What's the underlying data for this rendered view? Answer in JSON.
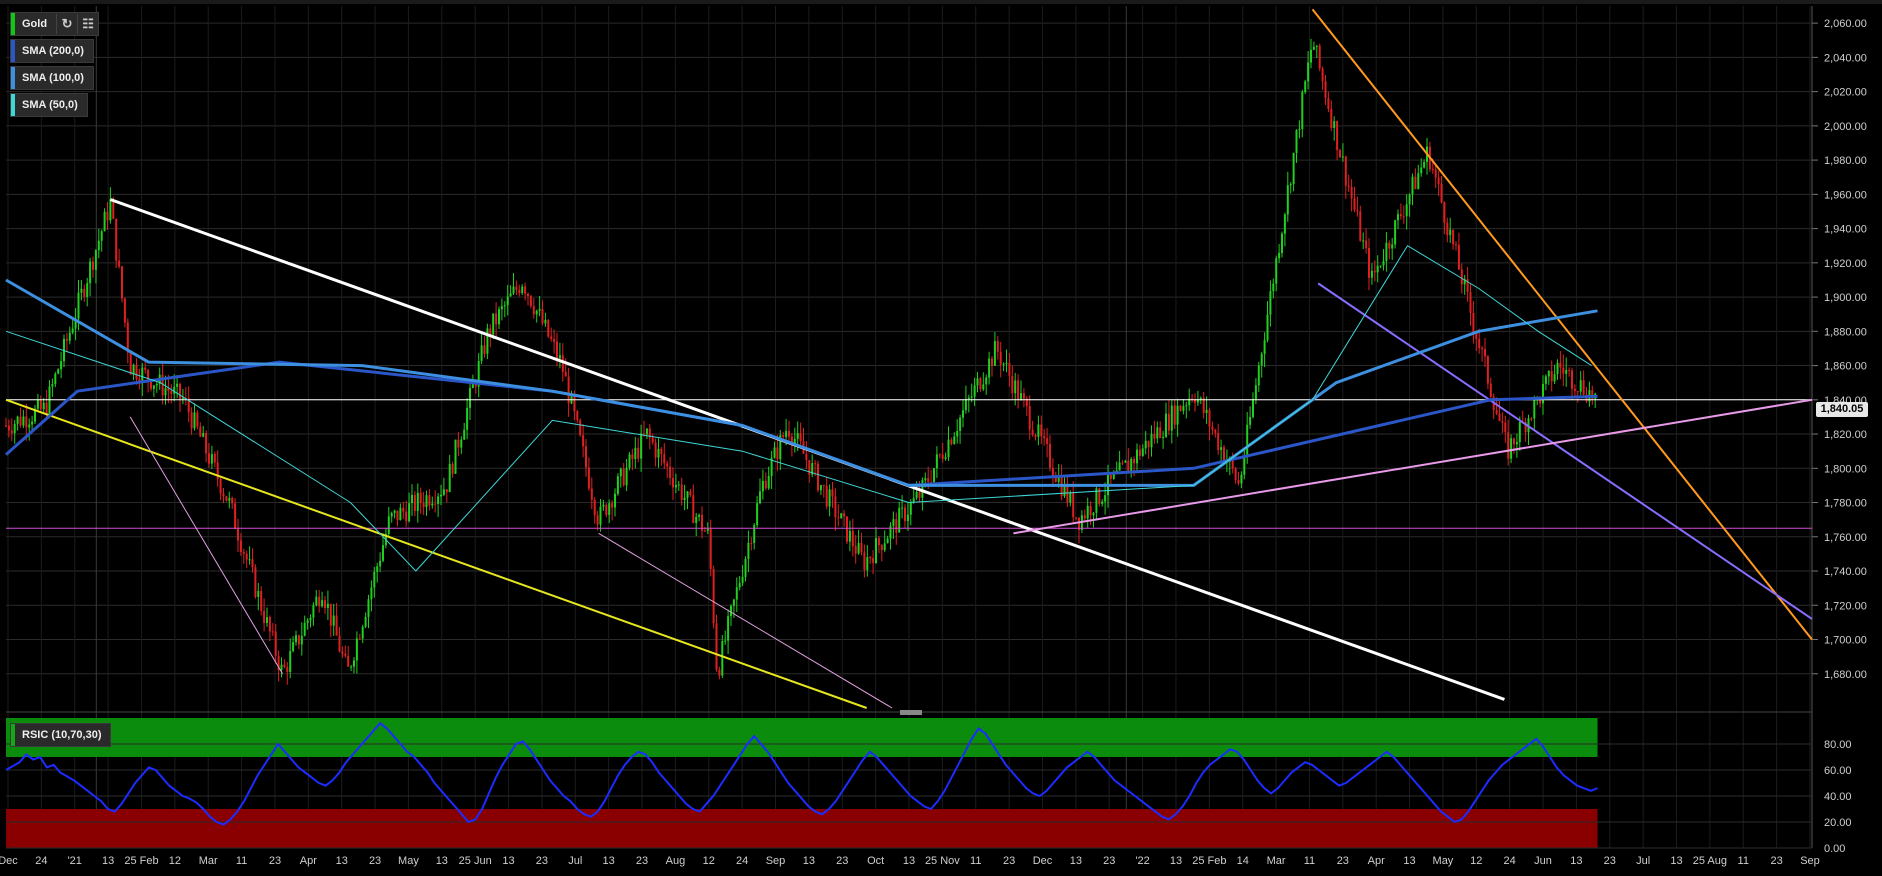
{
  "instrument": {
    "name": "Gold",
    "color": "#11c811"
  },
  "legend": [
    {
      "label": "SMA (200,0)",
      "color": "#2a56c8"
    },
    {
      "label": "SMA (100,0)",
      "color": "#3d8fe0"
    },
    {
      "label": "SMA (50,0)",
      "color": "#3fd6d6"
    }
  ],
  "rsi_legend": {
    "label": "RSIC (10,70,30)",
    "color": "#15a815"
  },
  "toolbar": {
    "refresh_icon": "refresh-icon",
    "settings_icon": "chart-settings-icon"
  },
  "last_price": "1,840.05",
  "chart_data": [
    {
      "type": "candlestick",
      "title": "Gold",
      "ylim": [
        1660,
        2070
      ],
      "y_ticks": [
        "2,060.00",
        "2,040.00",
        "2,020.00",
        "2,000.00",
        "1,980.00",
        "1,960.00",
        "1,940.00",
        "1,920.00",
        "1,900.00",
        "1,880.00",
        "1,860.00",
        "1,840.00",
        "1,820.00",
        "1,800.00",
        "1,780.00",
        "1,760.00",
        "1,740.00",
        "1,720.00",
        "1,700.00",
        "1,680.00"
      ],
      "x_ticks": [
        "Dec",
        "24",
        "'21",
        "13",
        "25 Feb",
        "12",
        "Mar",
        "11",
        "23",
        "Apr",
        "13",
        "23",
        "May",
        "13",
        "25 Jun",
        "13",
        "23",
        "Jul",
        "13",
        "23",
        "Aug",
        "12",
        "24",
        "Sep",
        "13",
        "23",
        "Oct",
        "13",
        "25 Nov",
        "11",
        "23",
        "Dec",
        "13",
        "23",
        "'22",
        "13",
        "25 Feb",
        "14",
        "Mar",
        "11",
        "23",
        "Apr",
        "13",
        "May",
        "12",
        "24",
        "Jun",
        "13",
        "23",
        "Jul",
        "13",
        "25 Aug",
        "11",
        "23",
        "Sep"
      ],
      "approx_close_path": [
        [
          "2020-11-30",
          1825
        ],
        [
          "2020-12-14",
          1835
        ],
        [
          "2021-01-06",
          1955
        ],
        [
          "2021-01-13",
          1860
        ],
        [
          "2021-02-01",
          1840
        ],
        [
          "2021-02-17",
          1780
        ],
        [
          "2021-03-08",
          1680
        ],
        [
          "2021-03-22",
          1730
        ],
        [
          "2021-03-31",
          1680
        ],
        [
          "2021-04-15",
          1770
        ],
        [
          "2021-05-05",
          1790
        ],
        [
          "2021-05-20",
          1880
        ],
        [
          "2021-06-01",
          1910
        ],
        [
          "2021-06-15",
          1860
        ],
        [
          "2021-06-28",
          1770
        ],
        [
          "2021-07-15",
          1820
        ],
        [
          "2021-08-06",
          1760
        ],
        [
          "2021-08-09",
          1680
        ],
        [
          "2021-08-25",
          1790
        ],
        [
          "2021-09-03",
          1825
        ],
        [
          "2021-09-30",
          1745
        ],
        [
          "2021-10-20",
          1785
        ],
        [
          "2021-11-16",
          1870
        ],
        [
          "2021-12-15",
          1770
        ],
        [
          "2022-01-25",
          1845
        ],
        [
          "2022-02-10",
          1790
        ],
        [
          "2022-03-08",
          2050
        ],
        [
          "2022-03-29",
          1910
        ],
        [
          "2022-04-18",
          1985
        ],
        [
          "2022-05-16",
          1810
        ],
        [
          "2022-06-03",
          1860
        ],
        [
          "2022-06-17",
          1840
        ]
      ],
      "sma_series": [
        {
          "name": "SMA (200,0)",
          "color": "#2a56c8",
          "values": [
            [
              0,
              1808
            ],
            [
              60,
              1845
            ],
            [
              230,
              1862
            ],
            [
              460,
              1845
            ],
            [
              620,
              1825
            ],
            [
              760,
              1790
            ],
            [
              1000,
              1800
            ],
            [
              1250,
              1840
            ],
            [
              1340,
              1842
            ]
          ]
        },
        {
          "name": "SMA (100,0)",
          "color": "#3d8fe0",
          "values": [
            [
              0,
              1910
            ],
            [
              120,
              1862
            ],
            [
              300,
              1860
            ],
            [
              460,
              1845
            ],
            [
              620,
              1825
            ],
            [
              760,
              1790
            ],
            [
              1000,
              1790
            ],
            [
              1120,
              1850
            ],
            [
              1240,
              1880
            ],
            [
              1340,
              1892
            ]
          ]
        },
        {
          "name": "SMA (50,0)",
          "color": "#3fd6d6",
          "values": [
            [
              0,
              1880
            ],
            [
              130,
              1850
            ],
            [
              290,
              1780
            ],
            [
              345,
              1740
            ],
            [
              460,
              1828
            ],
            [
              620,
              1810
            ],
            [
              760,
              1780
            ],
            [
              1000,
              1790
            ],
            [
              1100,
              1840
            ],
            [
              1180,
              1930
            ],
            [
              1240,
              1905
            ],
            [
              1290,
              1880
            ],
            [
              1335,
              1860
            ]
          ]
        }
      ],
      "trendlines": [
        {
          "name": "white-downtrend",
          "color": "#ffffff",
          "from": [
            "2021-01-06",
            1957
          ],
          "to": [
            "2022-05-15",
            1665
          ]
        },
        {
          "name": "yellow-downtrend",
          "color": "#e6e61f",
          "from": [
            "2020-11-30",
            1840
          ],
          "to": [
            "2021-10-01",
            1660
          ]
        },
        {
          "name": "orange-downtrend",
          "color": "#ff9a1f",
          "from": [
            "2022-03-08",
            2068
          ],
          "to": [
            "2022-09-01",
            1700
          ]
        },
        {
          "name": "purple-downtrend",
          "color": "#8a6cff",
          "from": [
            "2022-03-10",
            1908
          ],
          "to": [
            "2022-09-01",
            1712
          ]
        },
        {
          "name": "pink-uptrend",
          "color": "#e89ae8",
          "from": [
            "2021-11-22",
            1762
          ],
          "to": [
            "2022-09-01",
            1840
          ]
        },
        {
          "name": "pink-channel-1",
          "color": "#e0a0e0",
          "from": [
            "2021-01-13",
            1830
          ],
          "to": [
            "2021-03-08",
            1680
          ]
        },
        {
          "name": "pink-channel-2",
          "color": "#e0a0e0",
          "from": [
            "2021-06-28",
            1762
          ],
          "to": [
            "2021-10-10",
            1660
          ]
        },
        {
          "name": "horizontal-support",
          "color": "#d24fd2",
          "level": 1765
        },
        {
          "name": "horizontal-last",
          "color": "#ffffff",
          "level": 1840.05
        }
      ]
    },
    {
      "type": "line",
      "title": "RSIC (10,70,30)",
      "ylim": [
        0,
        100
      ],
      "y_ticks": [
        "80.00",
        "60.00",
        "40.00",
        "20.00",
        "0.00"
      ],
      "overbought": 70,
      "oversold": 30,
      "color": "#1c2cff",
      "values": [
        60,
        63,
        66,
        72,
        68,
        70,
        62,
        64,
        58,
        55,
        52,
        48,
        44,
        40,
        36,
        30,
        28,
        34,
        42,
        50,
        56,
        62,
        60,
        54,
        48,
        44,
        40,
        38,
        35,
        30,
        24,
        20,
        18,
        22,
        28,
        36,
        46,
        56,
        64,
        72,
        80,
        74,
        68,
        62,
        58,
        54,
        50,
        48,
        52,
        58,
        66,
        72,
        78,
        84,
        90,
        96,
        92,
        86,
        80,
        74,
        70,
        64,
        58,
        50,
        44,
        38,
        32,
        26,
        20,
        22,
        30,
        42,
        54,
        64,
        72,
        80,
        82,
        76,
        68,
        60,
        52,
        46,
        40,
        36,
        30,
        26,
        24,
        28,
        36,
        46,
        56,
        64,
        70,
        74,
        72,
        66,
        58,
        52,
        46,
        40,
        34,
        30,
        28,
        34,
        40,
        48,
        56,
        64,
        72,
        80,
        86,
        80,
        74,
        66,
        58,
        50,
        44,
        38,
        32,
        28,
        26,
        30,
        36,
        44,
        52,
        60,
        68,
        74,
        70,
        64,
        58,
        52,
        46,
        40,
        36,
        32,
        30,
        36,
        44,
        54,
        64,
        74,
        84,
        92,
        88,
        80,
        72,
        64,
        58,
        52,
        46,
        42,
        40,
        44,
        50,
        56,
        62,
        66,
        70,
        74,
        70,
        64,
        58,
        52,
        48,
        44,
        40,
        36,
        32,
        28,
        24,
        22,
        26,
        32,
        40,
        50,
        58,
        64,
        68,
        72,
        76,
        74,
        68,
        60,
        52,
        46,
        42,
        46,
        52,
        58,
        62,
        66,
        64,
        60,
        56,
        52,
        48,
        50,
        54,
        58,
        62,
        66,
        70,
        74,
        70,
        64,
        58,
        52,
        46,
        40,
        34,
        28,
        24,
        20,
        22,
        28,
        36,
        44,
        52,
        58,
        64,
        68,
        72,
        76,
        80,
        84,
        78,
        70,
        62,
        56,
        52,
        48,
        46,
        44,
        46
      ]
    }
  ]
}
